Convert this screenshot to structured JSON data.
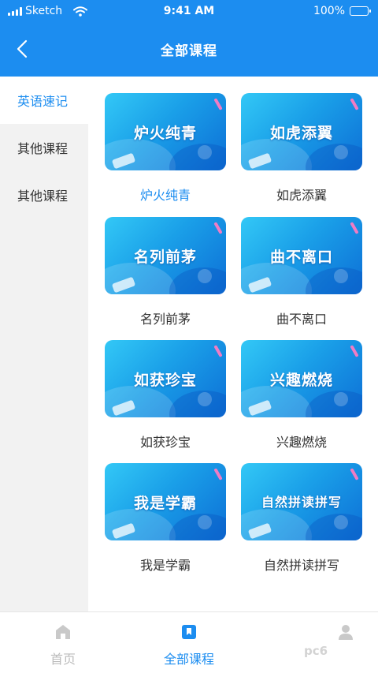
{
  "status": {
    "carrier": "Sketch",
    "time": "9:41 AM",
    "battery": "100%"
  },
  "header": {
    "title": "全部课程"
  },
  "sidebar": {
    "items": [
      {
        "label": "英语速记"
      },
      {
        "label": "其他课程"
      },
      {
        "label": "其他课程"
      }
    ]
  },
  "courses": [
    {
      "label": "炉火纯青",
      "thumb": "炉火纯青"
    },
    {
      "label": "如虎添翼",
      "thumb": "如虎添翼"
    },
    {
      "label": "名列前茅",
      "thumb": "名列前茅"
    },
    {
      "label": "曲不离口",
      "thumb": "曲不离口"
    },
    {
      "label": "如获珍宝",
      "thumb": "如获珍宝"
    },
    {
      "label": "兴趣燃烧",
      "thumb": "兴趣燃烧"
    },
    {
      "label": "我是学霸",
      "thumb": "我是学霸"
    },
    {
      "label": "自然拼读拼写",
      "thumb": "自然拼读拼写"
    }
  ],
  "tabs": [
    {
      "label": "首页",
      "icon": "home-icon"
    },
    {
      "label": "全部课程",
      "icon": "bookmark-icon"
    },
    {
      "label": "",
      "icon": "user-icon"
    }
  ],
  "watermark": "pc6",
  "colors": {
    "primary": "#1c8df0",
    "sidebar_bg": "#f2f2f2",
    "inactive": "#bbbbbb"
  }
}
